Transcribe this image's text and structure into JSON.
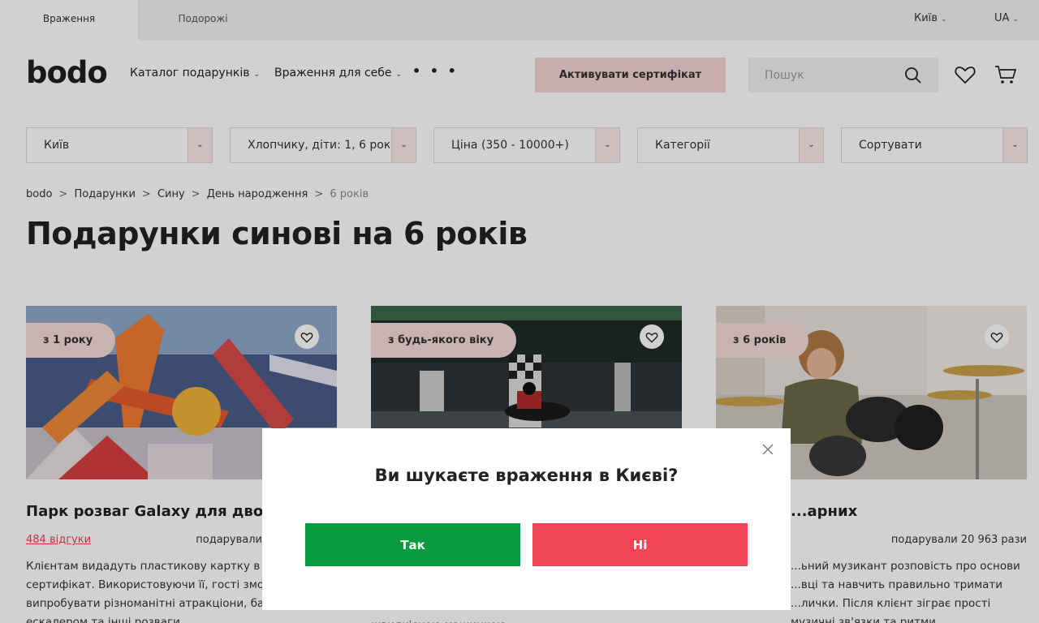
{
  "topbar": {
    "tabs": [
      "Враження",
      "Подорожі"
    ],
    "city": "Київ",
    "lang": "UA"
  },
  "header": {
    "logo": "bodo",
    "nav": [
      {
        "label": "Каталог подарунків"
      },
      {
        "label": "Враження для себе"
      }
    ],
    "more": "• • •",
    "activate_label": "Активувати сертифікат",
    "search_placeholder": "Пошук",
    "icons": [
      "search-icon",
      "heart-icon",
      "cart-icon"
    ]
  },
  "filters": [
    {
      "label": "Київ"
    },
    {
      "label": "Хлопчику, діти: 1, 6 років"
    },
    {
      "label": "Ціна (350 - 10000+)"
    },
    {
      "label": "Категорії"
    },
    {
      "label": "Сортувати"
    }
  ],
  "breadcrumb": [
    "bodo",
    "Подарунки",
    "Сину",
    "День народження",
    "6 років"
  ],
  "page_title": "Подарунки синові на 6 років",
  "cards": [
    {
      "badge": "з 1 року",
      "title": "Парк розваг Galaxy для двох",
      "reviews": "484 відгуки",
      "gifted": "подарували",
      "desc": "Клієнтам видадуть пластикову картку в об... сертифікат. Використовуючи її, гості зможу... випробувати різноманітні атракціони, бат... ескалером та інші розваги"
    },
    {
      "badge": "з будь-якого віку",
      "title": "",
      "reviews": "",
      "gifted": "",
      "desc": "швидкісною машинкою"
    },
    {
      "badge": "з 6 років",
      "title": "...арних",
      "reviews": "",
      "gifted": "подарували 20 963 рази",
      "desc": "...ьний музикант розповість про основи ...вці та навчить правильно тримати ...лички. Після клієнт зіграє прості музичні зв'язки та ритми"
    }
  ],
  "modal": {
    "question": "Ви шукаєте враження в Києві?",
    "yes": "Так",
    "no": "Ні"
  },
  "colors": {
    "accent_pink": "#f6d3d5",
    "yes_green": "#079a3f",
    "no_red": "#ef4557",
    "link_red": "#e2434f"
  }
}
